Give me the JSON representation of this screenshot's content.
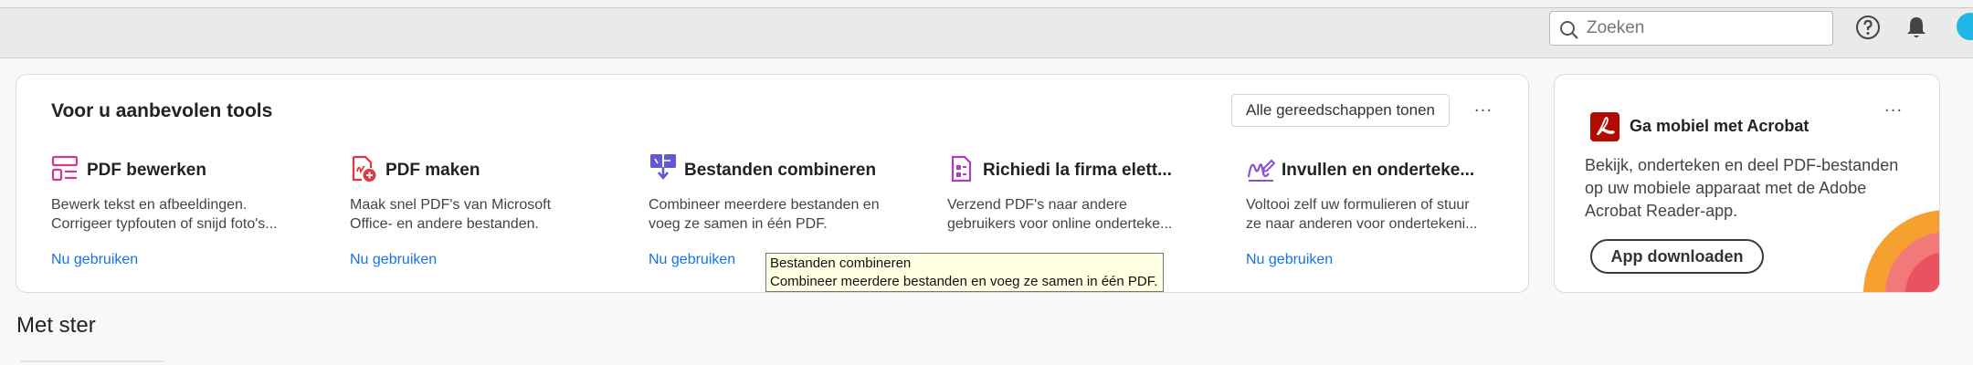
{
  "header": {
    "search_placeholder": "Zoeken",
    "icons": [
      "search-icon",
      "help-icon",
      "bell-icon",
      "avatar"
    ]
  },
  "tools_card": {
    "title": "Voor u aanbevolen tools",
    "all_tools_label": "Alle gereedschappen tonen",
    "more_label": "···",
    "tools": [
      {
        "name": "PDF bewerken",
        "desc_line1": "Bewerk tekst en afbeeldingen.",
        "desc_line2": "Corrigeer typfouten of snijd foto's...",
        "link": "Nu gebruiken",
        "icon": "edit-pdf-icon",
        "color": "#d83790"
      },
      {
        "name": "PDF maken",
        "desc_line1": "Maak snel PDF's van Microsoft",
        "desc_line2": "Office- en andere bestanden.",
        "link": "Nu gebruiken",
        "icon": "create-pdf-icon",
        "color": "#e0383e"
      },
      {
        "name": "Bestanden combineren",
        "desc_line1": "Combineer meerdere bestanden en",
        "desc_line2": "voeg ze samen in één PDF.",
        "link": "Nu gebruiken",
        "icon": "combine-files-icon",
        "color": "#6259d6"
      },
      {
        "name": "Richiedi la firma elett...",
        "desc_line1": "Verzend PDF's naar andere",
        "desc_line2": "gebruikers voor online onderteke...",
        "link": "",
        "icon": "request-signature-icon",
        "color": "#b03cc2"
      },
      {
        "name": "Invullen en onderteke...",
        "desc_line1": "Voltooi zelf uw formulieren of stuur",
        "desc_line2": "ze naar anderen voor ondertekeni...",
        "link": "Nu gebruiken",
        "icon": "fill-sign-icon",
        "color": "#8a4fd8"
      }
    ]
  },
  "tooltip": {
    "line1": "Bestanden combineren",
    "line2": "Combineer meerdere bestanden en voeg ze samen in één PDF."
  },
  "mobile_card": {
    "title": "Ga mobiel met Acrobat",
    "more_label": "···",
    "desc_line1": "Bekijk, onderteken en deel PDF-bestanden",
    "desc_line2": "op uw mobiele apparaat met de Adobe",
    "desc_line3": "Acrobat Reader-app.",
    "button_label": "App downloaden",
    "icon": "acrobat-icon",
    "brand_color": "#b30b00"
  },
  "section": {
    "starred_title": "Met ster"
  },
  "colors": {
    "link": "#1473e6",
    "accent_orange": "#f5a030",
    "accent_red": "#e8535f"
  }
}
